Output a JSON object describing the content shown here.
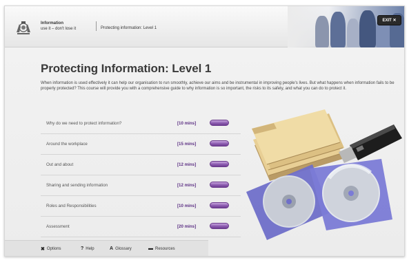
{
  "header": {
    "brand_line1": "Information",
    "brand_line2": "use it – don't lose it",
    "breadcrumb": "Protecting information: Level 1",
    "exit_label": "EXIT ✕"
  },
  "main": {
    "title": "Protecting Information: Level 1",
    "intro": "When information is used effectively it can help our organisation to run smoothly, achieve our aims and be instrumental in improving people's lives. But what happens when information fails to be properly protected? This course will provide you with a comprehensive guide to why information is so important, the risks to its safety, and what you can do to protect it.",
    "topics": [
      {
        "name": "Why do we need to protect information?",
        "duration": "[10 mins]"
      },
      {
        "name": "Around the workplace",
        "duration": "[15 mins]"
      },
      {
        "name": "Out and about",
        "duration": "[12 mins]"
      },
      {
        "name": "Sharing and sending information",
        "duration": "[12 mins]"
      },
      {
        "name": "Roles and Responsibilities",
        "duration": "[10 mins]"
      },
      {
        "name": "Assessment",
        "duration": "[20 mins]"
      }
    ]
  },
  "footer": {
    "options": "Options",
    "help": "Help",
    "glossary": "Glossary",
    "resources": "Resources"
  },
  "colors": {
    "accent_purple": "#6f3f93",
    "duration_text": "#5a2d82",
    "exit_bg": "#2a2a2a"
  },
  "icons": {
    "options": "tools-icon",
    "help": "question-icon",
    "glossary": "az-icon",
    "resources": "folder-icon"
  }
}
